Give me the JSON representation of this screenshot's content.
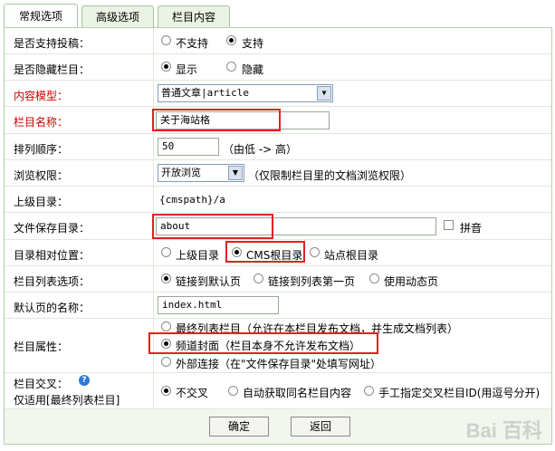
{
  "tabs": [
    "常规选项",
    "高级选项",
    "栏目内容"
  ],
  "contribute": {
    "label": "是否支持投稿：",
    "options": [
      "不支持",
      "支持"
    ],
    "selected": 1
  },
  "hidden": {
    "label": "是否隐藏栏目：",
    "options": [
      "显示",
      "隐藏"
    ],
    "selected": 0
  },
  "model": {
    "label": "内容模型：",
    "value": "普通文章|article"
  },
  "name": {
    "label": "栏目名称：",
    "value": "关于海站格"
  },
  "order": {
    "label": "排列顺序：",
    "value": "50",
    "hint": "（由低 -> 高）"
  },
  "perm": {
    "label": "浏览权限：",
    "value": "开放浏览",
    "hint": "（仅限制栏目里的文档浏览权限）"
  },
  "parent": {
    "label": "上级目录：",
    "value": "{cmspath}/a"
  },
  "savedir": {
    "label": "文件保存目录：",
    "value": "about",
    "pinyin": "拼音"
  },
  "relpos": {
    "label": "目录相对位置：",
    "options": [
      "上级目录",
      "CMS根目录",
      "站点根目录"
    ],
    "selected": 1
  },
  "listopt": {
    "label": "栏目列表选项：",
    "options": [
      "链接到默认页",
      "链接到列表第一页",
      "使用动态页"
    ],
    "selected": 0
  },
  "defpage": {
    "label": "默认页的名称：",
    "value": "index.html"
  },
  "attr": {
    "label": "栏目属性：",
    "options": [
      "最终列表栏目（允许在本栏目发布文档，并生成文档列表）",
      "频道封面（栏目本身不允许发布文档）",
      "外部连接（在\"文件保存目录\"处填写网址）"
    ],
    "selected": 1
  },
  "cross": {
    "label": "栏目交叉：",
    "sub": "仅适用[最终列表栏目]",
    "help": "?",
    "options": [
      "不交叉",
      "自动获取同名栏目内容",
      "手工指定交叉栏目ID(用逗号分开)"
    ],
    "selected": 0
  },
  "buttons": {
    "ok": "确定",
    "back": "返回"
  },
  "watermark": "Bai 百科"
}
